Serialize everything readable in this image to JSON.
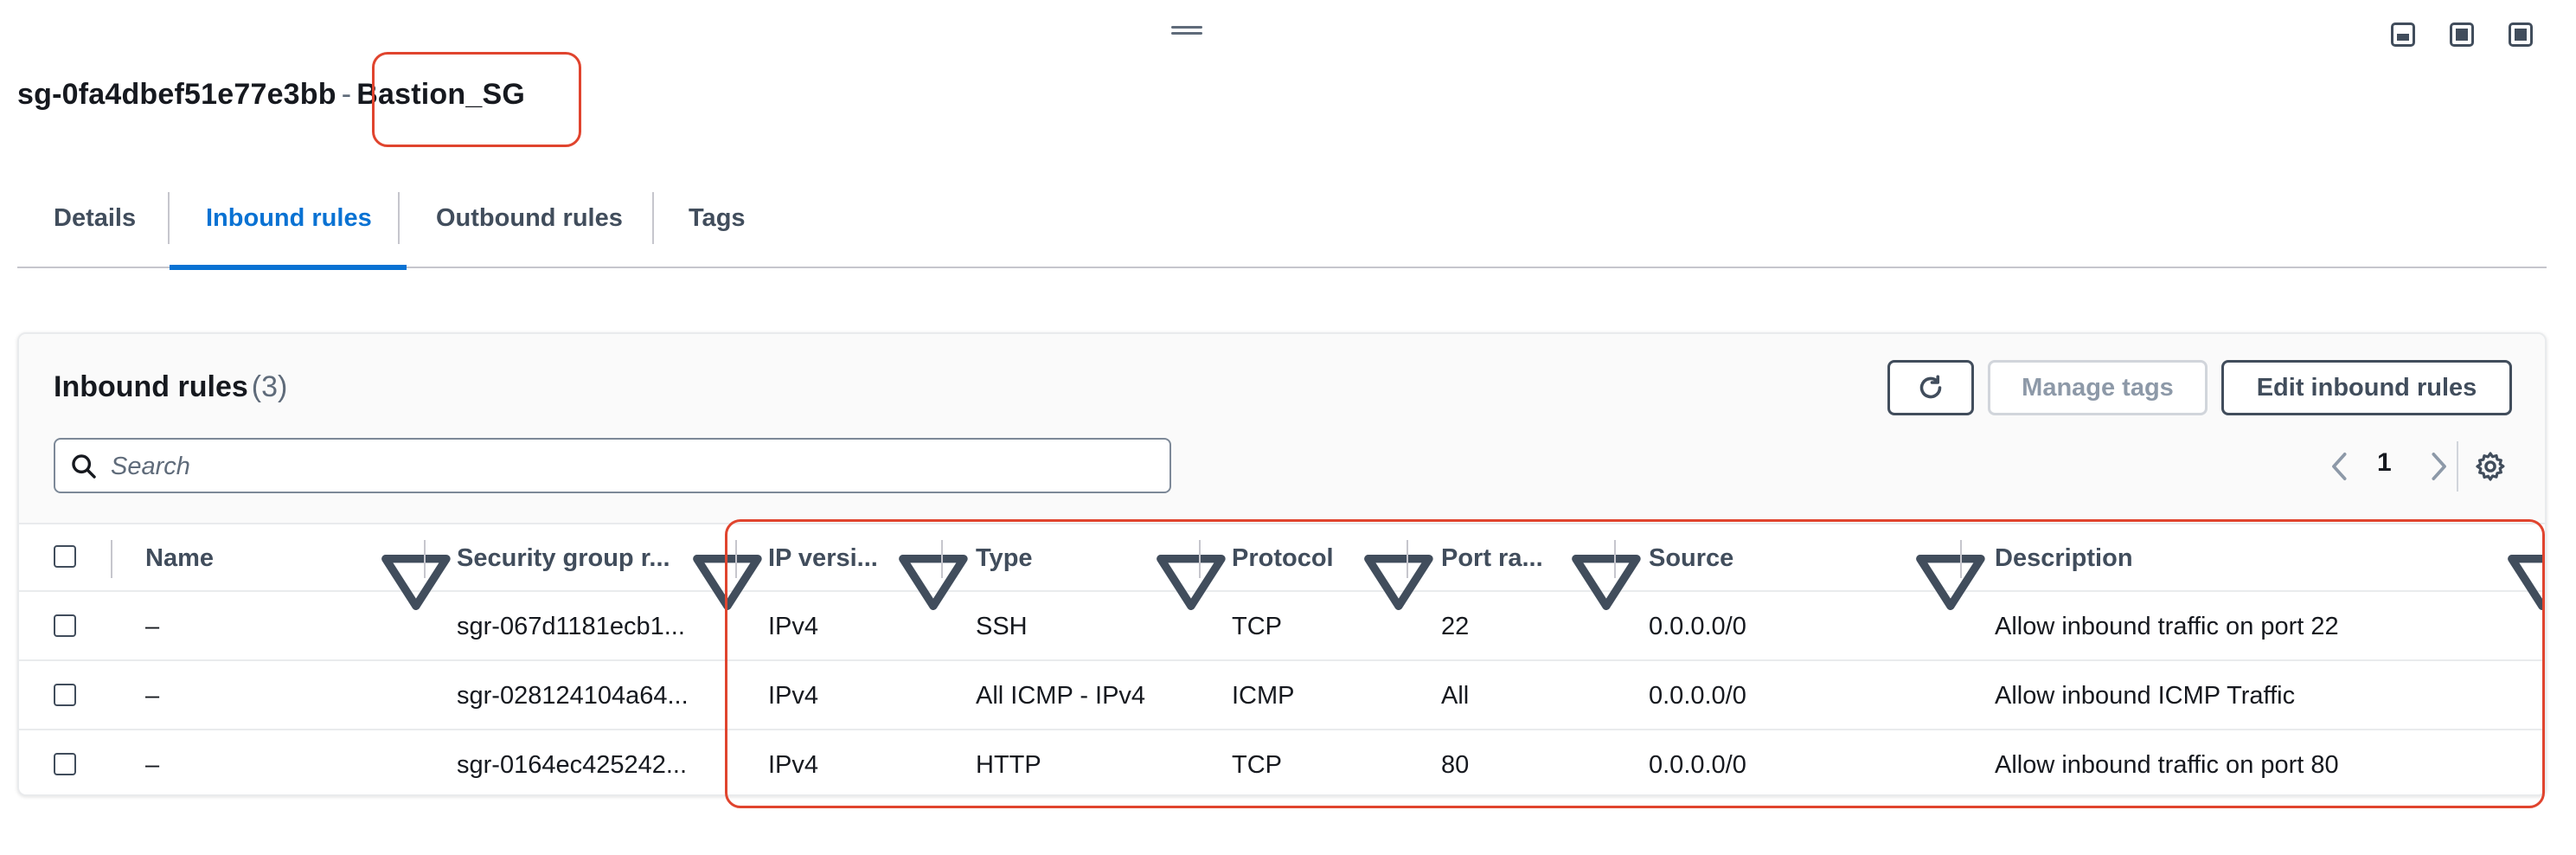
{
  "header": {
    "sg_id": "sg-0fa4dbef51e77e3bb",
    "separator": "-",
    "sg_name": "Bastion_SG"
  },
  "tabs": [
    {
      "label": "Details",
      "active": false
    },
    {
      "label": "Inbound rules",
      "active": true
    },
    {
      "label": "Outbound rules",
      "active": false
    },
    {
      "label": "Tags",
      "active": false
    }
  ],
  "panel": {
    "title": "Inbound rules",
    "count": "(3)",
    "manage_tags_label": "Manage tags",
    "edit_label": "Edit inbound rules",
    "search_placeholder": "Search",
    "page": "1"
  },
  "table": {
    "columns": [
      "Name",
      "Security group r...",
      "IP versi...",
      "Type",
      "Protocol",
      "Port ra...",
      "Source",
      "Description"
    ],
    "rows": [
      [
        "–",
        "sgr-067d1181ecb1...",
        "IPv4",
        "SSH",
        "TCP",
        "22",
        "0.0.0.0/0",
        "Allow inbound traffic on port 22"
      ],
      [
        "–",
        "sgr-028124104a64...",
        "IPv4",
        "All ICMP - IPv4",
        "ICMP",
        "All",
        "0.0.0.0/0",
        "Allow inbound ICMP Traffic"
      ],
      [
        "–",
        "sgr-0164ec425242...",
        "IPv4",
        "HTTP",
        "TCP",
        "80",
        "0.0.0.0/0",
        "Allow inbound traffic on port 80"
      ]
    ]
  },
  "colors": {
    "accent": "#0972d3",
    "highlight": "#e0442e",
    "text": "#16191f"
  },
  "icons": [
    "drag-handle-icon",
    "layout-icon",
    "refresh-icon",
    "search-icon",
    "chevron-left-icon",
    "chevron-right-icon",
    "gear-icon",
    "sort-caret-icon",
    "checkbox-icon"
  ]
}
